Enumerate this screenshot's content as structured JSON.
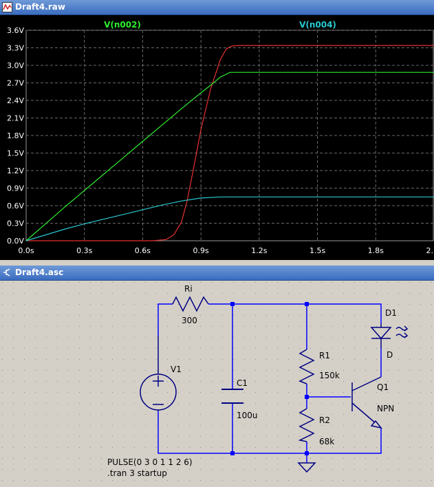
{
  "windows": {
    "plot_title": "Draft4.raw",
    "schematic_title": "Draft4.asc"
  },
  "chart_data": {
    "type": "line",
    "title": "",
    "xlabel": "",
    "ylabel": "",
    "x_ticks": [
      "0.0s",
      "0.3s",
      "0.6s",
      "0.9s",
      "1.2s",
      "1.5s",
      "1.8s",
      "2."
    ],
    "y_ticks": [
      "0.0V",
      "0.3V",
      "0.6V",
      "0.9V",
      "1.2V",
      "1.5V",
      "1.8V",
      "2.1V",
      "2.4V",
      "2.7V",
      "3.0V",
      "3.3V",
      "3.6V"
    ],
    "xlim": [
      0,
      2.1
    ],
    "ylim": [
      0,
      3.6
    ],
    "grid": true,
    "legend": "top",
    "colors": {
      "background": "#000000",
      "grid": "#6a6a6a",
      "axis_text": "#ffffff"
    },
    "series": [
      {
        "name": "V(n002)",
        "color": "#2ef02e",
        "x": [
          0,
          0.1,
          0.2,
          0.3,
          0.4,
          0.5,
          0.6,
          0.7,
          0.8,
          0.9,
          0.95,
          1.0,
          1.05,
          1.1,
          1.5,
          2.1
        ],
        "y": [
          0,
          0.29,
          0.58,
          0.86,
          1.14,
          1.42,
          1.7,
          1.98,
          2.26,
          2.53,
          2.66,
          2.8,
          2.88,
          2.88,
          2.88,
          2.88
        ]
      },
      {
        "name": "V(n004)",
        "color": "#28c8d2",
        "x": [
          0,
          0.1,
          0.2,
          0.3,
          0.4,
          0.5,
          0.6,
          0.7,
          0.8,
          0.9,
          1.0,
          1.1,
          1.5,
          2.1
        ],
        "y": [
          0,
          0.1,
          0.2,
          0.29,
          0.37,
          0.45,
          0.53,
          0.61,
          0.68,
          0.73,
          0.75,
          0.75,
          0.75,
          0.75
        ]
      }
    ],
    "unlabeled_series": [
      {
        "color": "#e83030",
        "x": [
          0,
          0.5,
          0.65,
          0.72,
          0.76,
          0.8,
          0.83,
          0.86,
          0.9,
          0.95,
          1.0,
          1.03,
          1.06,
          1.1,
          1.5,
          2.1
        ],
        "y": [
          0,
          0,
          0,
          0.02,
          0.1,
          0.32,
          0.7,
          1.2,
          1.9,
          2.6,
          3.1,
          3.28,
          3.33,
          3.34,
          3.34,
          3.34
        ]
      }
    ]
  },
  "schematic": {
    "components": {
      "ri": {
        "name": "Ri",
        "value": "300"
      },
      "v1": {
        "name": "V1"
      },
      "c1": {
        "name": "C1",
        "value": "100u"
      },
      "r1": {
        "name": "R1",
        "value": "150k"
      },
      "r2": {
        "name": "R2",
        "value": "68k"
      },
      "q1": {
        "name": "Q1",
        "value": "NPN"
      },
      "d1": {
        "name": "D1",
        "value": "D"
      }
    },
    "directives": {
      "source": "PULSE(0 3 0 1 1 2 6)",
      "tran": ".tran 3 startup"
    },
    "colors": {
      "wire": "#0000ff",
      "component": "#000080",
      "node": "#0000ff",
      "background": "#d4d0c8",
      "dots": "#8a8a8a"
    }
  }
}
